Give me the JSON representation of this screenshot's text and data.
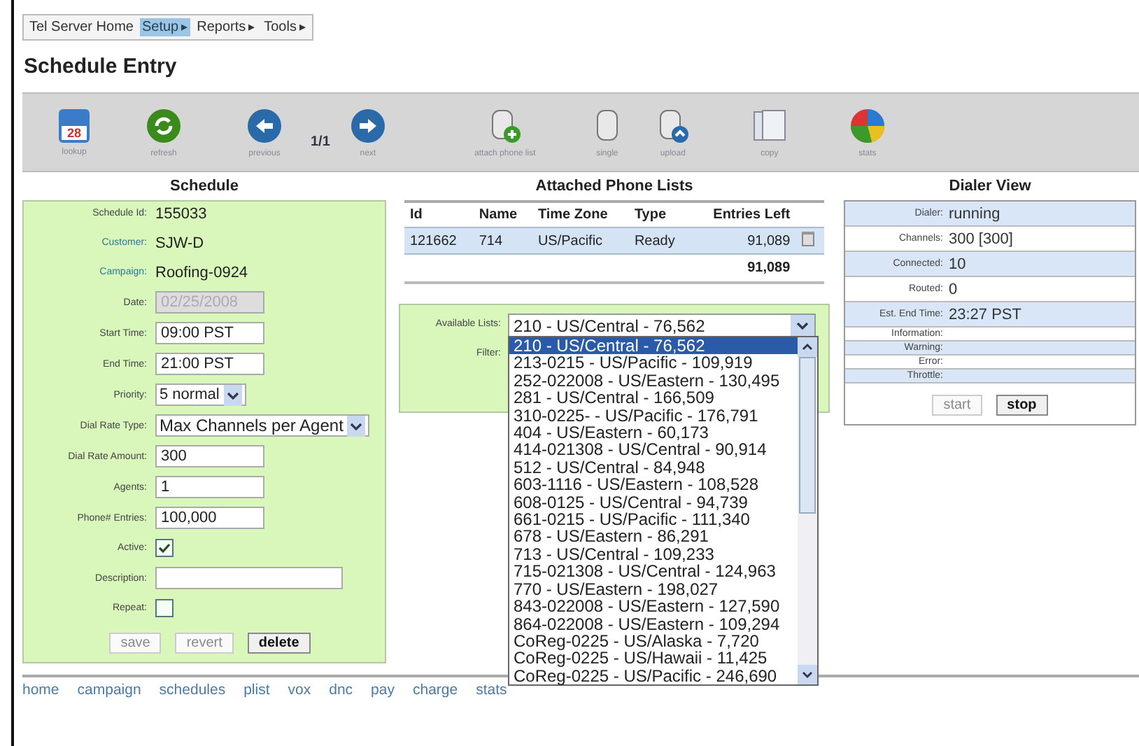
{
  "nav": [
    {
      "label": "Tel Server Home",
      "selected": false,
      "submenu": false
    },
    {
      "label": "Setup",
      "selected": true,
      "submenu": true
    },
    {
      "label": "Reports",
      "selected": false,
      "submenu": true
    },
    {
      "label": "Tools",
      "selected": false,
      "submenu": true
    }
  ],
  "submenu_marker": "▸",
  "page_title": "Schedule Entry",
  "toolbar": [
    {
      "kind": "calendar",
      "label": "lookup",
      "icon_text": "28"
    },
    {
      "kind": "refresh",
      "label": "refresh"
    },
    {
      "kind": "back",
      "label": "previous"
    },
    {
      "kind": "pager",
      "label": "1/1"
    },
    {
      "kind": "forward",
      "label": "next"
    },
    {
      "kind": "attach",
      "label": "attach phone list"
    },
    {
      "kind": "single",
      "label": "single"
    },
    {
      "kind": "upload",
      "label": "upload"
    },
    {
      "kind": "copy",
      "label": "copy"
    },
    {
      "kind": "stats",
      "label": "stats"
    }
  ],
  "schedule": {
    "heading": "Schedule",
    "fields": [
      {
        "kind": "text",
        "label": "Schedule Id:",
        "link": false,
        "value": "155033"
      },
      {
        "kind": "text",
        "label": "Customer:",
        "link": true,
        "value": "SJW-D"
      },
      {
        "kind": "text",
        "label": "Campaign:",
        "link": true,
        "value": "Roofing-0924"
      },
      {
        "kind": "input",
        "label": "Date:",
        "value": "02/25/2008",
        "disabled": true
      },
      {
        "kind": "input",
        "label": "Start Time:",
        "value": "09:00 PST",
        "disabled": false
      },
      {
        "kind": "input",
        "label": "End Time:",
        "value": "21:00 PST",
        "disabled": false
      },
      {
        "kind": "select",
        "label": "Priority:",
        "value": "5 normal",
        "wide": false
      },
      {
        "kind": "select",
        "label": "Dial Rate Type:",
        "value": "Max Channels per Agent",
        "wide": true
      },
      {
        "kind": "input",
        "label": "Dial Rate Amount:",
        "value": "300",
        "disabled": false
      },
      {
        "kind": "input",
        "label": "Agents:",
        "value": "1",
        "disabled": false
      },
      {
        "kind": "input",
        "label": "Phone# Entries:",
        "value": "100,000",
        "disabled": false
      },
      {
        "kind": "checkbox",
        "label": "Active:",
        "checked": true
      },
      {
        "kind": "wideinput",
        "label": "Description:"
      },
      {
        "kind": "checkbox",
        "label": "Repeat:",
        "checked": false
      }
    ],
    "buttons": [
      {
        "label": "save",
        "disabled": true
      },
      {
        "label": "revert",
        "disabled": true
      },
      {
        "label": "delete",
        "disabled": false
      }
    ]
  },
  "phone_lists": {
    "heading": "Attached Phone Lists",
    "columns": [
      "Id",
      "Name",
      "Time Zone",
      "Type",
      "Entries Left"
    ],
    "rows": [
      [
        "121662",
        "714",
        "US/Pacific",
        "Ready",
        "91,089"
      ]
    ],
    "total": "91,089",
    "available_label": "Available Lists:",
    "available_value": "210 - US/Central - 76,562",
    "filter_label": "Filter:",
    "options": [
      {
        "label": "210 - US/Central - 76,562",
        "selected": true
      },
      {
        "label": "213-0215 - US/Pacific - 109,919",
        "selected": false
      },
      {
        "label": "252-022008 - US/Eastern - 130,495",
        "selected": false
      },
      {
        "label": "281 - US/Central - 166,509",
        "selected": false
      },
      {
        "label": "310-0225- - US/Pacific - 176,791",
        "selected": false
      },
      {
        "label": "404 - US/Eastern - 60,173",
        "selected": false
      },
      {
        "label": "414-021308 - US/Central - 90,914",
        "selected": false
      },
      {
        "label": "512 - US/Central - 84,948",
        "selected": false
      },
      {
        "label": "603-1116 - US/Eastern - 108,528",
        "selected": false
      },
      {
        "label": "608-0125 - US/Central - 94,739",
        "selected": false
      },
      {
        "label": "661-0215 - US/Pacific - 111,340",
        "selected": false
      },
      {
        "label": "678 - US/Eastern - 86,291",
        "selected": false
      },
      {
        "label": "713 - US/Central - 109,233",
        "selected": false
      },
      {
        "label": "715-021308 - US/Central - 124,963",
        "selected": false
      },
      {
        "label": "770 - US/Eastern - 198,027",
        "selected": false
      },
      {
        "label": "843-022008 - US/Eastern - 127,590",
        "selected": false
      },
      {
        "label": "864-022008 - US/Eastern - 109,294",
        "selected": false
      },
      {
        "label": "CoReg-0225 - US/Alaska - 7,720",
        "selected": false
      },
      {
        "label": "CoReg-0225 - US/Hawaii - 11,425",
        "selected": false
      },
      {
        "label": "CoReg-0225 - US/Pacific - 246,690",
        "selected": false
      }
    ]
  },
  "dialer": {
    "heading": "Dialer View",
    "rows": [
      {
        "kind": "value",
        "label": "Dialer:",
        "value": "running"
      },
      {
        "kind": "value",
        "label": "Channels:",
        "value": "300 [300]"
      },
      {
        "kind": "value",
        "label": "Connected:",
        "value": "10"
      },
      {
        "kind": "value",
        "label": "Routed:",
        "value": "0"
      },
      {
        "kind": "value",
        "label": "Est. End Time:",
        "value": "23:27 PST"
      },
      {
        "kind": "flag",
        "label": "Information:"
      },
      {
        "kind": "flag",
        "label": "Warning:"
      },
      {
        "kind": "flag",
        "label": "Error:"
      },
      {
        "kind": "flag",
        "label": "Throttle:"
      }
    ],
    "buttons": [
      {
        "label": "start",
        "disabled": true
      },
      {
        "label": "stop",
        "disabled": false
      }
    ]
  },
  "footer_links": [
    "home",
    "campaign",
    "schedules",
    "plist",
    "vox",
    "dnc",
    "pay",
    "charge",
    "stats"
  ]
}
